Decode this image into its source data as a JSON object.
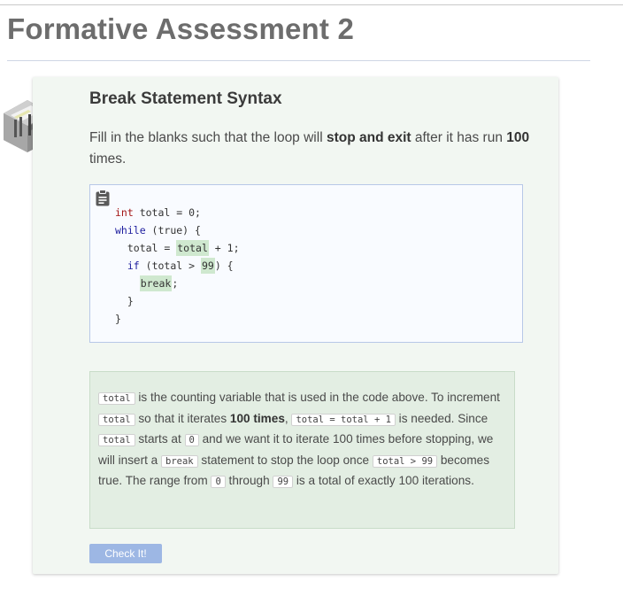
{
  "page": {
    "title": "Formative Assessment 2"
  },
  "card": {
    "title": "Break Statement Syntax",
    "instructions": {
      "t1": "Fill in the blanks such that the loop will ",
      "b1": "stop and exit",
      "t2": " after it has run ",
      "b2": "100",
      "t3": " times."
    },
    "code": {
      "l1_type": "int",
      "l1_rest": " total = 0;",
      "l2_kw": "while",
      "l2_rest": " (true) {",
      "l3_a": "total = ",
      "l3_blank": "total",
      "l3_b": " + 1;",
      "l4_kw": "if",
      "l4_a": " (total > ",
      "l4_blank": "99",
      "l4_b": ") {",
      "l5_blank": "break",
      "l5_b": ";",
      "l6": "}",
      "l7": "}"
    },
    "explanation": {
      "c1": "total",
      "t1": " is the counting variable that is used in the code above. To increment ",
      "c2": "total",
      "t2": " so that it iterates ",
      "b1": "100 times",
      "t3": ", ",
      "c3": "total = total + 1",
      "t4": " is needed. Since ",
      "c4": "total",
      "t5": " starts at ",
      "c5": "0",
      "t6": " and we want it to iterate 100 times before stopping, we will insert a ",
      "c6": "break",
      "t7": " statement to stop the loop once ",
      "c7": "total > 99",
      "t8": " becomes true. The range from ",
      "c8": "0",
      "t9": " through ",
      "c9": "99",
      "t10": " is a total of exactly 100 iterations."
    },
    "check_button": "Check It!"
  },
  "colors": {
    "accent": "#9db7e4",
    "blank_highlight": "#cfe8cf",
    "card_bg": "#f2f7f2"
  }
}
